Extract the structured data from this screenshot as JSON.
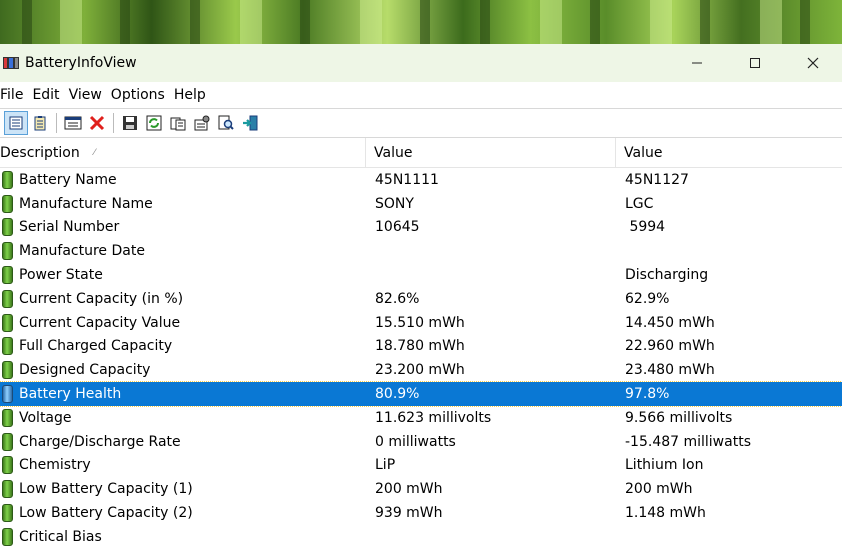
{
  "window": {
    "title": "BatteryInfoView",
    "minimize_icon": "minimize-icon",
    "maximize_icon": "maximize-icon",
    "close_icon": "close-icon"
  },
  "menu": [
    "File",
    "Edit",
    "View",
    "Options",
    "Help"
  ],
  "toolbar": {
    "icons": [
      "battery-info-view-icon",
      "battery-log-view-icon",
      "properties-window-icon",
      "delete-icon",
      "save-icon",
      "refresh-icon",
      "copy-icon",
      "options-icon",
      "find-icon",
      "exit-icon"
    ]
  },
  "columns": [
    "Description",
    "Value",
    "Value"
  ],
  "rows": [
    {
      "desc": "Battery Name",
      "v1": "45N1111",
      "v2": "45N1127"
    },
    {
      "desc": "Manufacture Name",
      "v1": "SONY",
      "v2": "LGC"
    },
    {
      "desc": "Serial Number",
      "v1": "10645",
      "v2": " 5994"
    },
    {
      "desc": "Manufacture Date",
      "v1": "",
      "v2": ""
    },
    {
      "desc": "Power State",
      "v1": "",
      "v2": "Discharging"
    },
    {
      "desc": "Current Capacity (in %)",
      "v1": "82.6%",
      "v2": "62.9%"
    },
    {
      "desc": "Current Capacity Value",
      "v1": "15.510 mWh",
      "v2": "14.450 mWh"
    },
    {
      "desc": "Full Charged Capacity",
      "v1": "18.780 mWh",
      "v2": "22.960 mWh"
    },
    {
      "desc": "Designed Capacity",
      "v1": "23.200 mWh",
      "v2": "23.480 mWh"
    },
    {
      "desc": "Battery Health",
      "v1": "80.9%",
      "v2": "97.8%",
      "selected": true
    },
    {
      "desc": "Voltage",
      "v1": "11.623 millivolts",
      "v2": "9.566 millivolts"
    },
    {
      "desc": "Charge/Discharge Rate",
      "v1": "0 milliwatts",
      "v2": "-15.487 milliwatts"
    },
    {
      "desc": "Chemistry",
      "v1": "LiP",
      "v2": "Lithium Ion"
    },
    {
      "desc": "Low Battery Capacity (1)",
      "v1": "200 mWh",
      "v2": "200 mWh"
    },
    {
      "desc": "Low Battery Capacity (2)",
      "v1": "939 mWh",
      "v2": "1.148 mWh"
    },
    {
      "desc": "Critical Bias",
      "v1": "",
      "v2": ""
    }
  ],
  "colors": {
    "selection": "#0a78d4",
    "titlebar": "#eef6e6"
  }
}
